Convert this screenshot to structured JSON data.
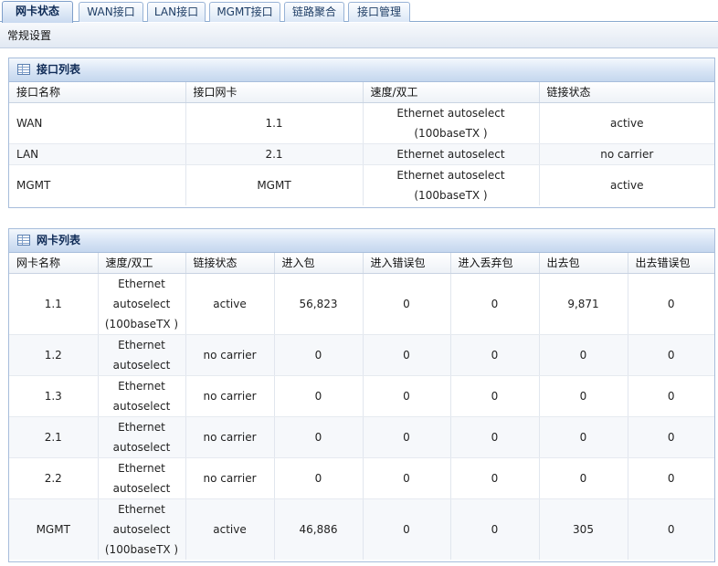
{
  "tabs": [
    {
      "label": "网卡状态",
      "active": true
    },
    {
      "label": "WAN接口",
      "active": false
    },
    {
      "label": "LAN接口",
      "active": false
    },
    {
      "label": "MGMT接口",
      "active": false
    },
    {
      "label": "链路聚合",
      "active": false
    },
    {
      "label": "接口管理",
      "active": false
    }
  ],
  "subbar": {
    "label": "常规设置"
  },
  "interface_panel": {
    "title": "接口列表",
    "headers": [
      "接口名称",
      "接口网卡",
      "速度/双工",
      "链接状态"
    ],
    "rows": [
      {
        "name": "WAN",
        "nic": "1.1",
        "speed": [
          "Ethernet autoselect",
          "(100baseTX )"
        ],
        "status": "active"
      },
      {
        "name": "LAN",
        "nic": "2.1",
        "speed": [
          "Ethernet autoselect"
        ],
        "status": "no carrier"
      },
      {
        "name": "MGMT",
        "nic": "MGMT",
        "speed": [
          "Ethernet autoselect",
          "(100baseTX )"
        ],
        "status": "active"
      }
    ]
  },
  "nic_panel": {
    "title": "网卡列表",
    "headers": [
      "网卡名称",
      "速度/双工",
      "链接状态",
      "进入包",
      "进入错误包",
      "进入丢弃包",
      "出去包",
      "出去错误包"
    ],
    "rows": [
      {
        "name": "1.1",
        "speed": [
          "Ethernet",
          "autoselect",
          "(100baseTX )"
        ],
        "status": "active",
        "in_pkts": "56,823",
        "in_err": "0",
        "in_drop": "0",
        "out_pkts": "9,871",
        "out_err": "0"
      },
      {
        "name": "1.2",
        "speed": [
          "Ethernet",
          "autoselect"
        ],
        "status": "no carrier",
        "in_pkts": "0",
        "in_err": "0",
        "in_drop": "0",
        "out_pkts": "0",
        "out_err": "0"
      },
      {
        "name": "1.3",
        "speed": [
          "Ethernet",
          "autoselect"
        ],
        "status": "no carrier",
        "in_pkts": "0",
        "in_err": "0",
        "in_drop": "0",
        "out_pkts": "0",
        "out_err": "0"
      },
      {
        "name": "2.1",
        "speed": [
          "Ethernet",
          "autoselect"
        ],
        "status": "no carrier",
        "in_pkts": "0",
        "in_err": "0",
        "in_drop": "0",
        "out_pkts": "0",
        "out_err": "0"
      },
      {
        "name": "2.2",
        "speed": [
          "Ethernet",
          "autoselect"
        ],
        "status": "no carrier",
        "in_pkts": "0",
        "in_err": "0",
        "in_drop": "0",
        "out_pkts": "0",
        "out_err": "0"
      },
      {
        "name": "MGMT",
        "speed": [
          "Ethernet",
          "autoselect",
          "(100baseTX )"
        ],
        "status": "active",
        "in_pkts": "46,886",
        "in_err": "0",
        "in_drop": "0",
        "out_pkts": "305",
        "out_err": "0"
      }
    ]
  }
}
